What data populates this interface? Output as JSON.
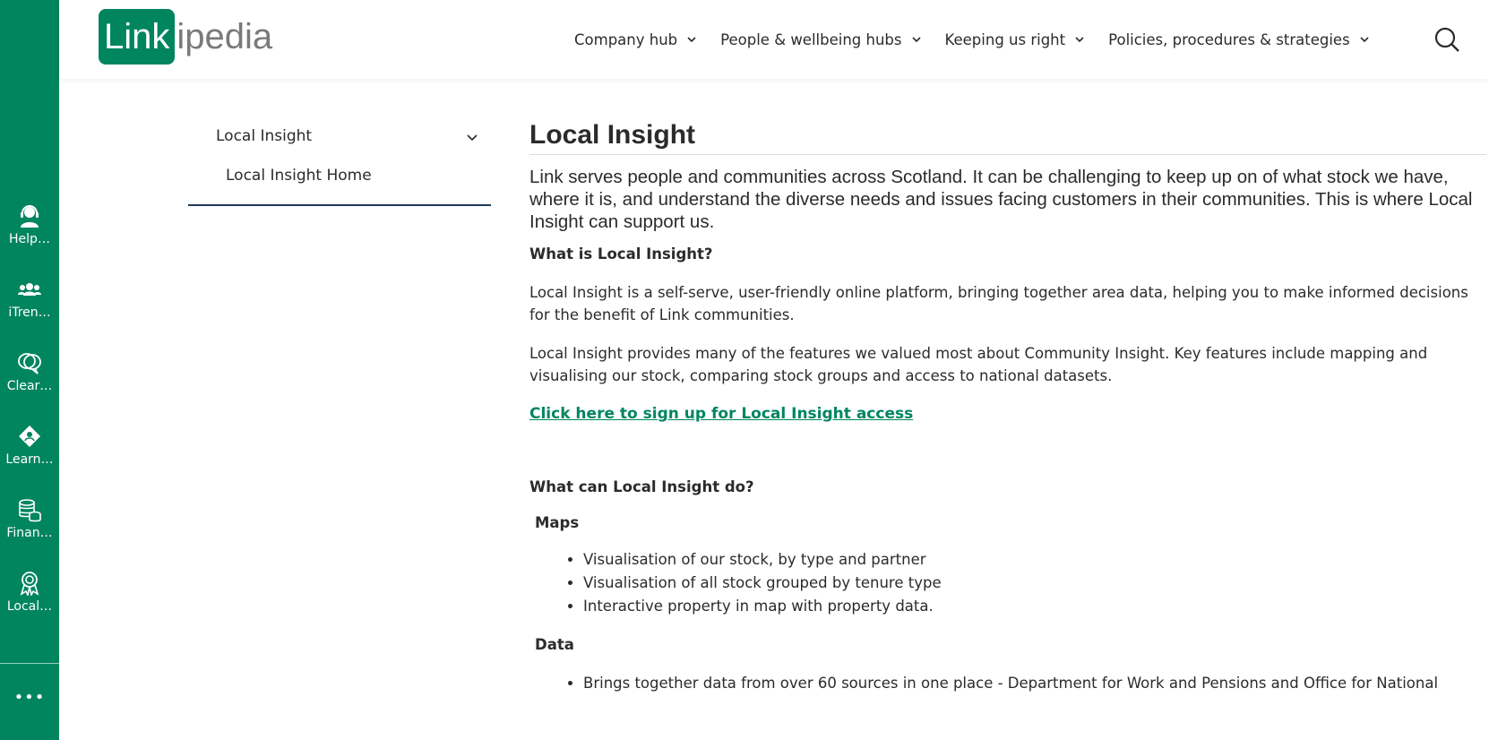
{
  "app_rail": {
    "items": [
      {
        "label": "Help…",
        "icon": "headset-icon"
      },
      {
        "label": "iTren…",
        "icon": "people-group-icon"
      },
      {
        "label": "Clear…",
        "icon": "chat-bubbles-icon"
      },
      {
        "label": "Learn…",
        "icon": "learning-badge-icon"
      },
      {
        "label": "Finan…",
        "icon": "coins-icon"
      },
      {
        "label": "Local…",
        "icon": "award-ribbon-icon"
      }
    ],
    "more_label": "•••"
  },
  "header": {
    "logo_part1": "Link",
    "logo_part2": "ipedia",
    "nav": [
      {
        "label": "Company hub"
      },
      {
        "label": "People & wellbeing hubs"
      },
      {
        "label": "Keeping us right"
      },
      {
        "label": "Policies, procedures & strategies"
      }
    ]
  },
  "sidenav": {
    "heading": "Local Insight",
    "items": [
      {
        "label": "Local Insight Home"
      }
    ]
  },
  "main": {
    "title": "Local Insight",
    "lead": "Link serves people and communities across Scotland. It can be challenging to keep up on of what stock we have, where it is, and understand the diverse needs and issues facing customers in their communities. This is where Local Insight can support us.",
    "what_is_heading": "What is Local Insight?",
    "para1": "Local Insight is a self-serve, user-friendly online platform, bringing together area data, helping you to make informed decisions for the benefit of Link communities.",
    "para2": "Local Insight provides many of the features we valued most about Community Insight. Key features include mapping and visualising our stock, comparing stock groups and access to national datasets.",
    "signup_link": "Click here to sign up for Local Insight access",
    "what_can_heading": "What can Local Insight do?",
    "maps_heading": "Maps",
    "maps_items": [
      "Visualisation of our stock, by type and partner",
      "Visualisation of all stock grouped by tenure type",
      "Interactive property in map with property data."
    ],
    "data_heading": "Data",
    "data_items": [
      "Brings together data from over 60 sources in one place - Department for Work and Pensions and Office for National"
    ]
  },
  "colors": {
    "brand_green": "#00855f",
    "underline_navy": "#1f3a5a"
  }
}
